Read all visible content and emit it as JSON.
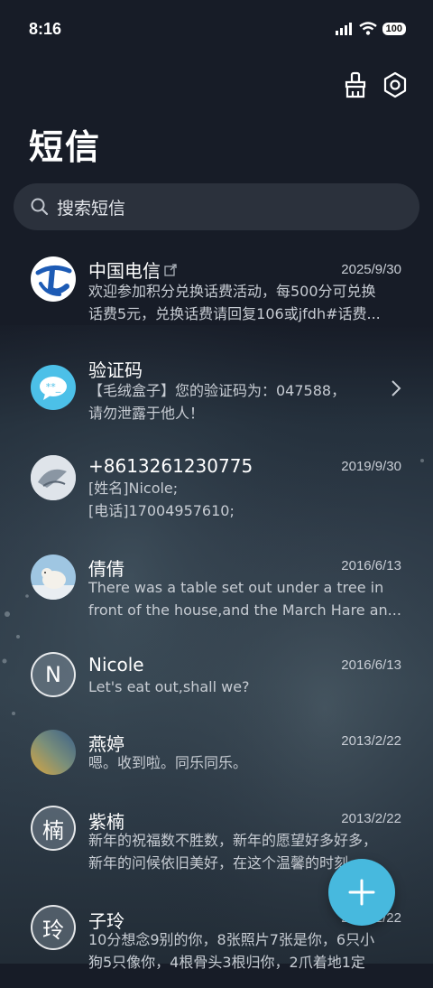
{
  "status_bar": {
    "time": "8:16",
    "battery": "100"
  },
  "header": {
    "title": "短信",
    "clean_icon": "broom-icon",
    "settings_icon": "settings-gear-icon"
  },
  "search": {
    "placeholder": "搜索短信",
    "icon": "search-icon"
  },
  "conversations": [
    {
      "name": "中国电信",
      "date": "2025/9/30",
      "lines": [
        "欢迎参加积分兑换话费活动，每500分可兑换",
        "话费5元，兑换话费请回复106或jfdh#话费..."
      ],
      "avatar": "china-telecom-logo"
    },
    {
      "name": "验证码",
      "date": "",
      "lines": [
        "【毛绒盒子】您的验证码为：047588，",
        "请勿泄露于他人！"
      ],
      "avatar": "verification-code-chat-icon"
    },
    {
      "name": "+8613261230775",
      "date": "2019/9/30",
      "lines": [
        "[姓名]Nicole;",
        "[电话]17004957610;"
      ],
      "avatar": "photo-avatar"
    },
    {
      "name": "倩倩",
      "date": "2016/6/13",
      "lines": [
        "There was a table set out under a tree in",
        "front of the house,and the March Hare an..."
      ],
      "avatar": "polar-bear-avatar"
    },
    {
      "name": "Nicole",
      "date": "2016/6/13",
      "lines": [
        "Let's eat out,shall we?"
      ],
      "avatar_letter": "N"
    },
    {
      "name": "燕婷",
      "date": "2013/2/22",
      "lines": [
        "嗯。收到啦。同乐同乐。"
      ],
      "avatar": "gradient-photo-avatar"
    },
    {
      "name": "紫楠",
      "date": "2013/2/22",
      "lines": [
        "新年的祝福数不胜数，新年的愿望好多好多，",
        "新年的问候依旧美好，在这个温馨的时刻"
      ],
      "avatar_letter": "楠"
    },
    {
      "name": "子玲",
      "date": "2013/2/22",
      "lines": [
        "10分想念9别的你，8张照片7张是你，6只小",
        "狗5只像你，4根骨头3根归你，2爪着地1定"
      ],
      "avatar_letter": "玲"
    }
  ],
  "fab": {
    "icon": "plus-icon",
    "color": "#47b9de"
  }
}
